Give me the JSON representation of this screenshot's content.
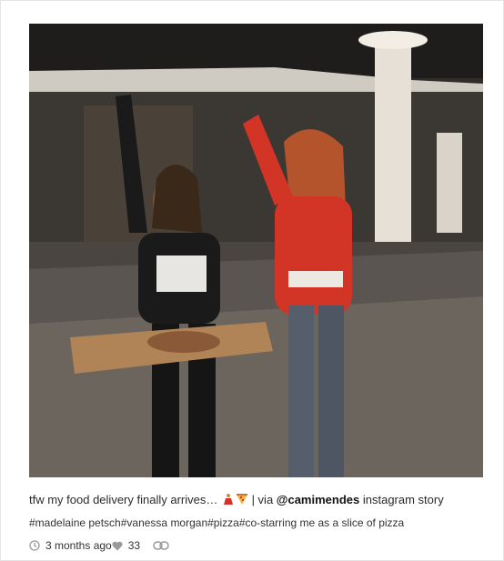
{
  "post": {
    "caption_text": "tfw my food delivery finally arrives… ",
    "caption_separator": " | via ",
    "mention": "@camimendes",
    "caption_suffix": " instagram story",
    "hashtags": "#madelaine petsch#vanessa morgan#pizza#co-starring me as a slice of pizza",
    "time_ago": "3 months ago",
    "like_count": "33"
  },
  "icons": {
    "time": "clock-icon",
    "likes": "heart-icon",
    "share": "link-icon",
    "emoji_1": "dancer-emoji",
    "emoji_2": "pizza-emoji"
  },
  "colors": {
    "mention": "#111111",
    "meta_icon": "#9a9a9a"
  }
}
